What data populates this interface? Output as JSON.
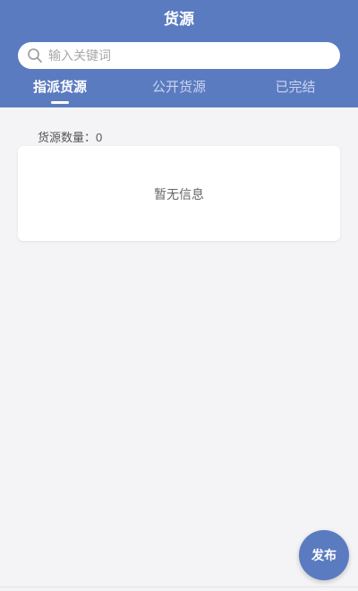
{
  "header": {
    "title": "货源",
    "background": "#5b7bc0"
  },
  "search": {
    "placeholder": "输入关键词",
    "value": ""
  },
  "tabs": [
    {
      "label": "指派货源",
      "active": true
    },
    {
      "label": "公开货源",
      "active": false
    },
    {
      "label": "已完结",
      "active": false
    }
  ],
  "summary": {
    "count_label": "货源数量：",
    "count_value": "0"
  },
  "empty_state": {
    "message": "暂无信息"
  },
  "fab": {
    "label": "发布"
  }
}
